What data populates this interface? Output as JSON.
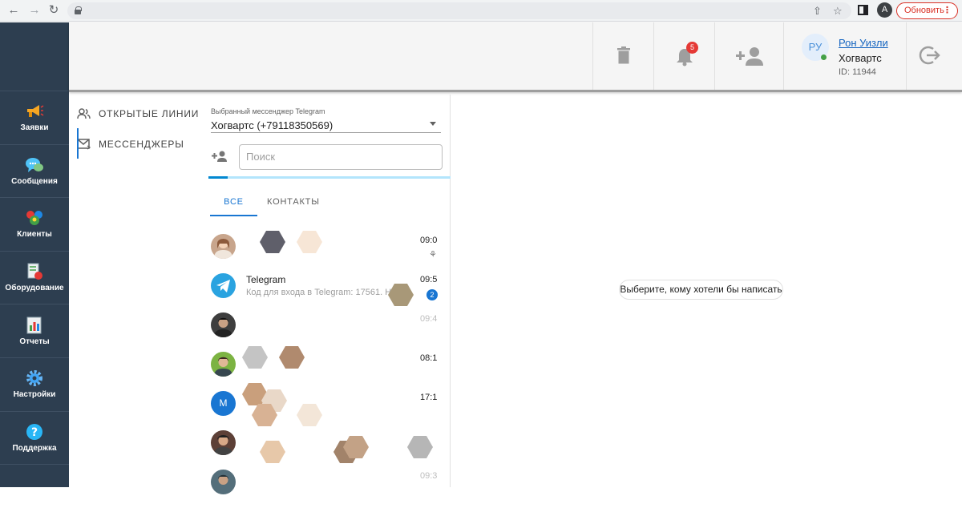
{
  "browser": {
    "avatar_letter": "A",
    "update_label": "Обновить",
    "menu_dots": "⋮"
  },
  "sidebar": {
    "items": [
      {
        "label": "Заявки",
        "icon": "megaphone-icon"
      },
      {
        "label": "Сообщения",
        "icon": "chat-bubbles-icon"
      },
      {
        "label": "Клиенты",
        "icon": "clients-icon"
      },
      {
        "label": "Оборудование",
        "icon": "equipment-icon"
      },
      {
        "label": "Отчеты",
        "icon": "reports-icon"
      },
      {
        "label": "Настройки",
        "icon": "gear-icon"
      },
      {
        "label": "Поддержка",
        "icon": "help-icon"
      }
    ]
  },
  "header": {
    "notifications_count": "5",
    "user": {
      "initials": "РУ",
      "name": "Рон Уизли",
      "org": "Хогвартс",
      "id": "ID: 11944"
    }
  },
  "subnav": {
    "items": [
      {
        "label": "ОТКРЫТЫЕ ЛИНИИ",
        "icon": "people-icon"
      },
      {
        "label": "МЕССЕНДЖЕРЫ",
        "icon": "mail-icon"
      }
    ],
    "active_index": 1
  },
  "panel": {
    "select_caption": "Выбранный мессенджер Telegram",
    "select_value": "Хогвартс (+79118350569)",
    "search_placeholder": "Поиск",
    "progress": 0.08,
    "tabs": [
      {
        "label": "ВСЕ",
        "active": true
      },
      {
        "label": "КОНТАКТЫ",
        "active": false
      }
    ],
    "chats": [
      {
        "title": "",
        "preview": "",
        "time": "09:0",
        "pinned": true,
        "avatar": "photo"
      },
      {
        "title": "Telegram",
        "preview": "Код для входа в Telegram: 17561. Н",
        "time": "09:5",
        "unread": "2",
        "avatar": "telegram"
      },
      {
        "title": "",
        "preview": "",
        "time": "09:4",
        "avatar": "photo"
      },
      {
        "title": "",
        "preview": "",
        "time": "08:1",
        "avatar": "photo"
      },
      {
        "title": "",
        "preview": "",
        "time": "17:1",
        "avatar": "letter",
        "letter": "M"
      },
      {
        "title": "",
        "preview": "",
        "time": "",
        "avatar": "photo"
      },
      {
        "title": "",
        "preview": "",
        "time": "09:3",
        "avatar": "photo"
      }
    ]
  },
  "main": {
    "hint": "Выберите, кому хотели бы написать"
  },
  "colors": {
    "sidebar_bg": "#2d3e50",
    "accent": "#1976d2",
    "badge": "#e53935",
    "telegram": "#2aa3e0"
  }
}
